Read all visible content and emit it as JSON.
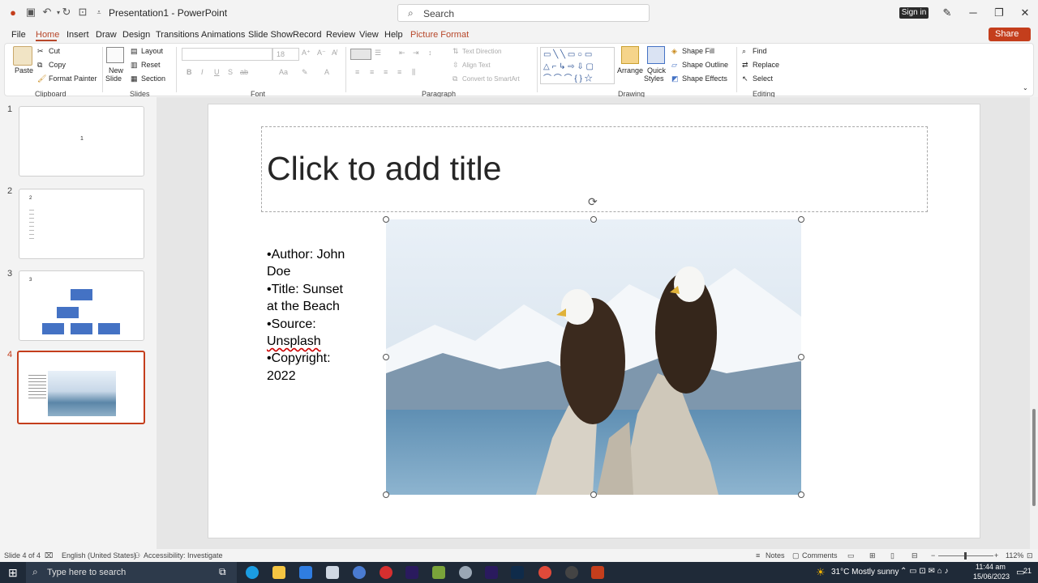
{
  "app": {
    "title": "Presentation1  -  PowerPoint",
    "search_placeholder": "Search",
    "signin_label": "Sign in"
  },
  "tabs": [
    "File",
    "Home",
    "Insert",
    "Draw",
    "Design",
    "Transitions",
    "Animations",
    "Slide Show",
    "Record",
    "Review",
    "View",
    "Help",
    "Picture Format"
  ],
  "share_label": "Share",
  "ribbon": {
    "clipboard": {
      "paste": "Paste",
      "cut": "Cut",
      "copy": "Copy",
      "format_painter": "Format Painter",
      "group": "Clipboard"
    },
    "slides": {
      "new_slide_1": "New",
      "new_slide_2": "Slide",
      "layout": "Layout",
      "reset": "Reset",
      "section": "Section",
      "group": "Slides"
    },
    "font": {
      "font_size": "18",
      "group": "Font",
      "bold": "B",
      "italic": "I",
      "underline": "U",
      "strike": "S",
      "strikethrough": "ab",
      "case": "Aa"
    },
    "paragraph": {
      "text_direction": "Text Direction",
      "align_text": "Align Text",
      "convert_smartart": "Convert to SmartArt",
      "group": "Paragraph"
    },
    "drawing": {
      "arrange": "Arrange",
      "quick_styles_1": "Quick",
      "quick_styles_2": "Styles",
      "shape_fill": "Shape Fill",
      "shape_outline": "Shape Outline",
      "shape_effects": "Shape Effects",
      "group": "Drawing"
    },
    "editing": {
      "find": "Find",
      "replace": "Replace",
      "select": "Select",
      "group": "Editing"
    }
  },
  "thumbnails": [
    {
      "number": "1",
      "label": "1"
    },
    {
      "number": "2",
      "label": "2"
    },
    {
      "number": "3",
      "label": "3"
    },
    {
      "number": "4",
      "label": ""
    }
  ],
  "slide": {
    "title_placeholder": "Click to add title",
    "body_lines": [
      "•Author: John",
      "Doe",
      "•Title: Sunset",
      "at the Beach",
      "•Source:",
      "Unsplash",
      "•Copyright:",
      "2022"
    ]
  },
  "status": {
    "slide_info": "Slide 4 of 4",
    "language": "English (United States)",
    "accessibility": "Accessibility: Investigate",
    "notes": "Notes",
    "comments": "Comments",
    "zoom": "112%"
  },
  "taskbar": {
    "search_placeholder": "Type here to search",
    "weather": "31°C  Mostly sunny",
    "time": "11:44 am",
    "date": "15/06/2023",
    "notification_count": "21"
  },
  "colors": {
    "accent": "#b7472a",
    "share": "#c43e1c",
    "taskbar": "#1f2a38"
  }
}
